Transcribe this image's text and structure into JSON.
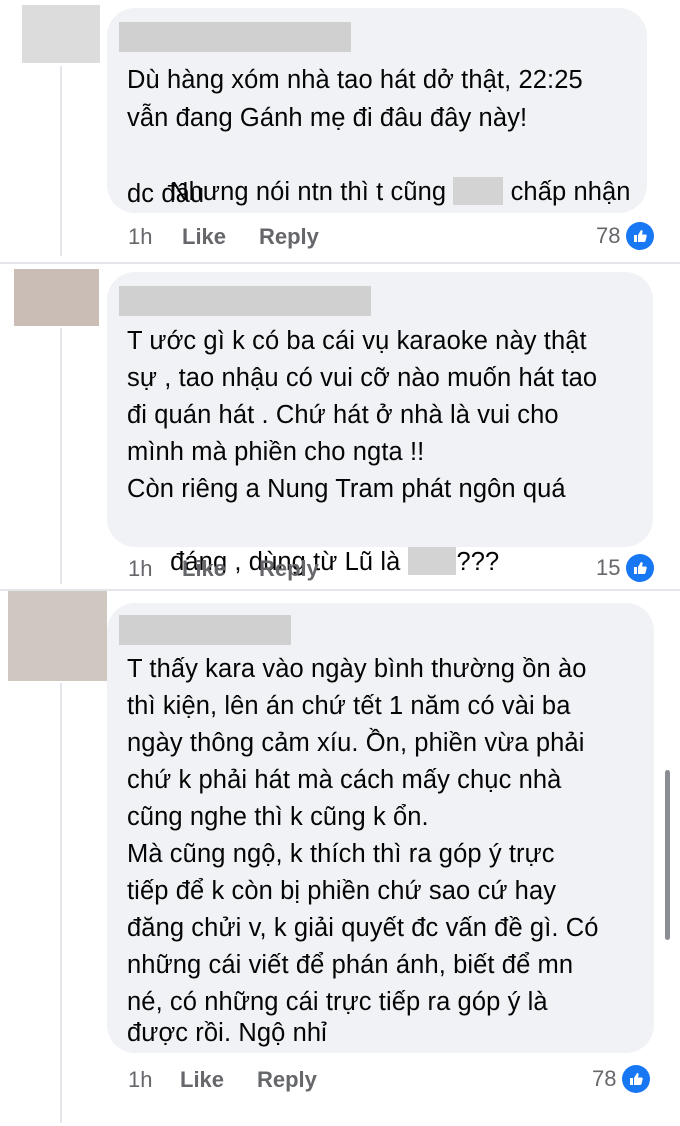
{
  "comments": [
    {
      "lines": [
        "Dù hàng xóm nhà tao hát dở thật, 22:25",
        "vẫn đang Gánh mẹ đi đâu đây này!",
        "Nhưng nói ntn thì t cũng",
        "dc đâu"
      ],
      "line3_after": "chấp nhận",
      "time": "1h",
      "like": "Like",
      "reply": "Reply",
      "reactions": "78"
    },
    {
      "lines": [
        "T ước gì k có ba cái vụ karaoke này thật",
        "sự , tao nhậu có vui cỡ nào muốn hát tao",
        "đi quán hát . Chứ hát ở nhà là vui cho",
        "mình mà phiền cho ngta !!",
        "Còn riêng a Nung Tram phát ngôn quá",
        "đáng , dùng từ Lũ là"
      ],
      "line6_after": "???",
      "time": "1h",
      "like": "Like",
      "reply": "Reply",
      "reactions": "15"
    },
    {
      "lines": [
        "T thấy kara vào ngày bình thường ồn ào",
        "thì kiện, lên án chứ tết 1 năm có vài ba",
        "ngày thông cảm xíu. Ồn, phiền vừa phải",
        "chứ k phải hát mà cách mấy chục nhà",
        "cũng nghe thì k cũng k ổn.",
        "Mà cũng ngộ, k thích thì ra góp ý trực",
        "tiếp để k còn bị phiền chứ sao cứ hay",
        "đăng chửi v, k giải quyết đc vấn đề gì. Có",
        "những cái viết để phán ánh, biết để mn",
        "né, có những cái trực tiếp ra góp ý là",
        "được rồi. Ngộ nhỉ"
      ],
      "time": "1h",
      "like": "Like",
      "reply": "Reply",
      "reactions": "78"
    }
  ],
  "icons": {
    "reaction": "like-thumb-icon"
  },
  "colors": {
    "like_blue": "#1877f2",
    "bubble": "#f0f2f5",
    "meta": "#65676b"
  }
}
